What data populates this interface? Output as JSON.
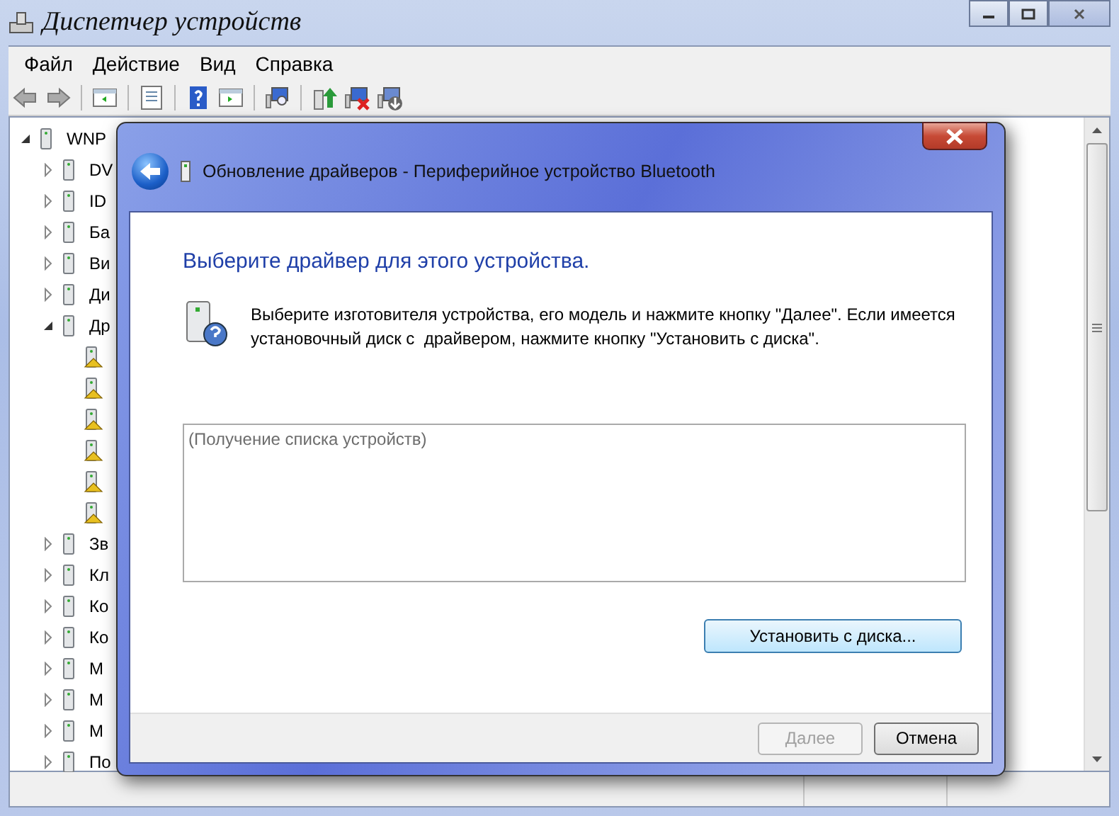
{
  "window": {
    "title": "Диспетчер устройств"
  },
  "menu": [
    "Файл",
    "Действие",
    "Вид",
    "Справка"
  ],
  "tree": {
    "label": "WNP",
    "expanded": true,
    "children": [
      {
        "label": "DV",
        "expanded": false
      },
      {
        "label": "ID",
        "expanded": false
      },
      {
        "label": "Ба",
        "expanded": false
      },
      {
        "label": "Ви",
        "expanded": false
      },
      {
        "label": "Ди",
        "expanded": false
      },
      {
        "label": "Др",
        "expanded": true,
        "children": [
          {
            "warning": true
          },
          {
            "warning": true
          },
          {
            "warning": true
          },
          {
            "warning": true
          },
          {
            "warning": true
          },
          {
            "warning": true
          }
        ]
      },
      {
        "label": "Зв",
        "expanded": false
      },
      {
        "label": "Кл",
        "expanded": false
      },
      {
        "label": "Ко",
        "expanded": false
      },
      {
        "label": "Ко",
        "expanded": false
      },
      {
        "label": "М",
        "expanded": false
      },
      {
        "label": "М",
        "expanded": false
      },
      {
        "label": "М",
        "expanded": false
      },
      {
        "label": "По",
        "expanded": false
      }
    ]
  },
  "dialog": {
    "title": "Обновление драйверов - Периферийное устройство Bluetooth",
    "heading": "Выберите драйвер для этого устройства.",
    "instruction": "Выберите изготовителя устройства, его модель и нажмите кнопку \"Далее\". Если имеется установочный диск с  драйвером, нажмите кнопку \"Установить с диска\".",
    "list_status": "(Получение списка устройств)",
    "have_disk_button": "Установить с диска...",
    "buttons": [
      {
        "label": "Далее",
        "disabled": true
      },
      {
        "label": "Отмена",
        "disabled": false
      }
    ]
  }
}
